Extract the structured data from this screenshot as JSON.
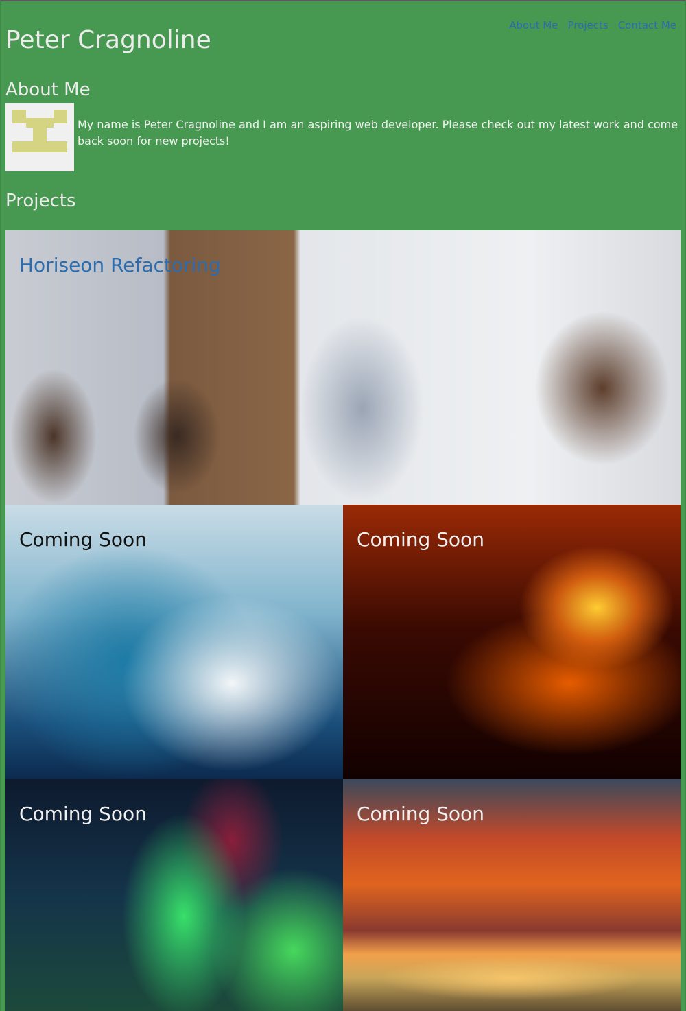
{
  "nav": {
    "items": [
      {
        "label": "About Me"
      },
      {
        "label": "Projects"
      },
      {
        "label": "Contact Me"
      }
    ]
  },
  "header": {
    "title": "Peter Cragnoline"
  },
  "about": {
    "heading": "About Me",
    "text": "My name is Peter Cragnoline and I am an aspiring web developer. Please check out my latest work and come back soon for new projects!"
  },
  "projects": {
    "heading": "Projects",
    "tiles": [
      {
        "label": "Horiseon Refactoring"
      },
      {
        "label": "Coming Soon"
      },
      {
        "label": "Coming Soon"
      },
      {
        "label": "Coming Soon"
      },
      {
        "label": "Coming Soon"
      }
    ]
  },
  "colors": {
    "background": "#479951",
    "link": "#2b6cb0",
    "heading": "#ececec",
    "avatar_accent": "#d4d482"
  }
}
